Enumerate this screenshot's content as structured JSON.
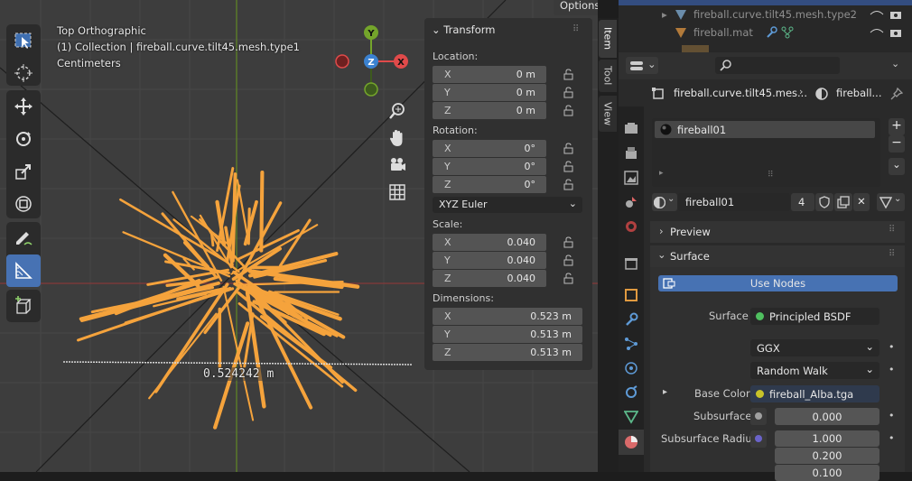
{
  "viewport": {
    "view_name": "Top Orthographic",
    "object_info": "(1) Collection | fireball.curve.tilt45.mesh.type1",
    "units": "Centimeters",
    "measure_label": "0.524242 m",
    "options_label": "Options",
    "gizmo": {
      "y": "Y",
      "z": "Z",
      "x": "X"
    }
  },
  "transform": {
    "title": "Transform",
    "location_label": "Location:",
    "location": [
      {
        "axis": "X",
        "value": "0 m"
      },
      {
        "axis": "Y",
        "value": "0 m"
      },
      {
        "axis": "Z",
        "value": "0 m"
      }
    ],
    "rotation_label": "Rotation:",
    "rotation": [
      {
        "axis": "X",
        "value": "0°"
      },
      {
        "axis": "Y",
        "value": "0°"
      },
      {
        "axis": "Z",
        "value": "0°"
      }
    ],
    "rotation_mode": "XYZ Euler",
    "scale_label": "Scale:",
    "scale": [
      {
        "axis": "X",
        "value": "0.040"
      },
      {
        "axis": "Y",
        "value": "0.040"
      },
      {
        "axis": "Z",
        "value": "0.040"
      }
    ],
    "dimensions_label": "Dimensions:",
    "dimensions": [
      {
        "axis": "X",
        "value": "0.523 m"
      },
      {
        "axis": "Y",
        "value": "0.513 m"
      },
      {
        "axis": "Z",
        "value": "0.513 m"
      }
    ]
  },
  "side_tabs": [
    "Item",
    "Tool",
    "View"
  ],
  "outliner": {
    "rows": [
      "fireball.curve.tilt45.mesh.type2",
      "fireball.mat"
    ]
  },
  "properties": {
    "breadcrumb_object": "fireball.curve.tilt45.mes...",
    "breadcrumb_material": "fireball...",
    "material_slot": "fireball01",
    "material_name": "fireball01",
    "user_count": "4",
    "preview_label": "Preview",
    "surface_label": "Surface",
    "use_nodes_label": "Use Nodes",
    "surface_field_label": "Surface",
    "surface_shader": "Principled BSDF",
    "distribution": "GGX",
    "subsurface_method": "Random Walk",
    "base_color_label": "Base Color",
    "base_color_value": "fireball_Alba.tga",
    "subsurface_label": "Subsurface",
    "subsurface_value": "0.000",
    "subsurface_radius_label": "Subsurface Radius",
    "subsurface_radius": [
      "1.000",
      "0.200",
      "0.100"
    ]
  },
  "colors": {
    "accent": "#4772b3",
    "object_orange": "#f5a33c",
    "axis_x": "#e04a4a",
    "axis_y": "#74a52b",
    "axis_z": "#3b82d1"
  }
}
